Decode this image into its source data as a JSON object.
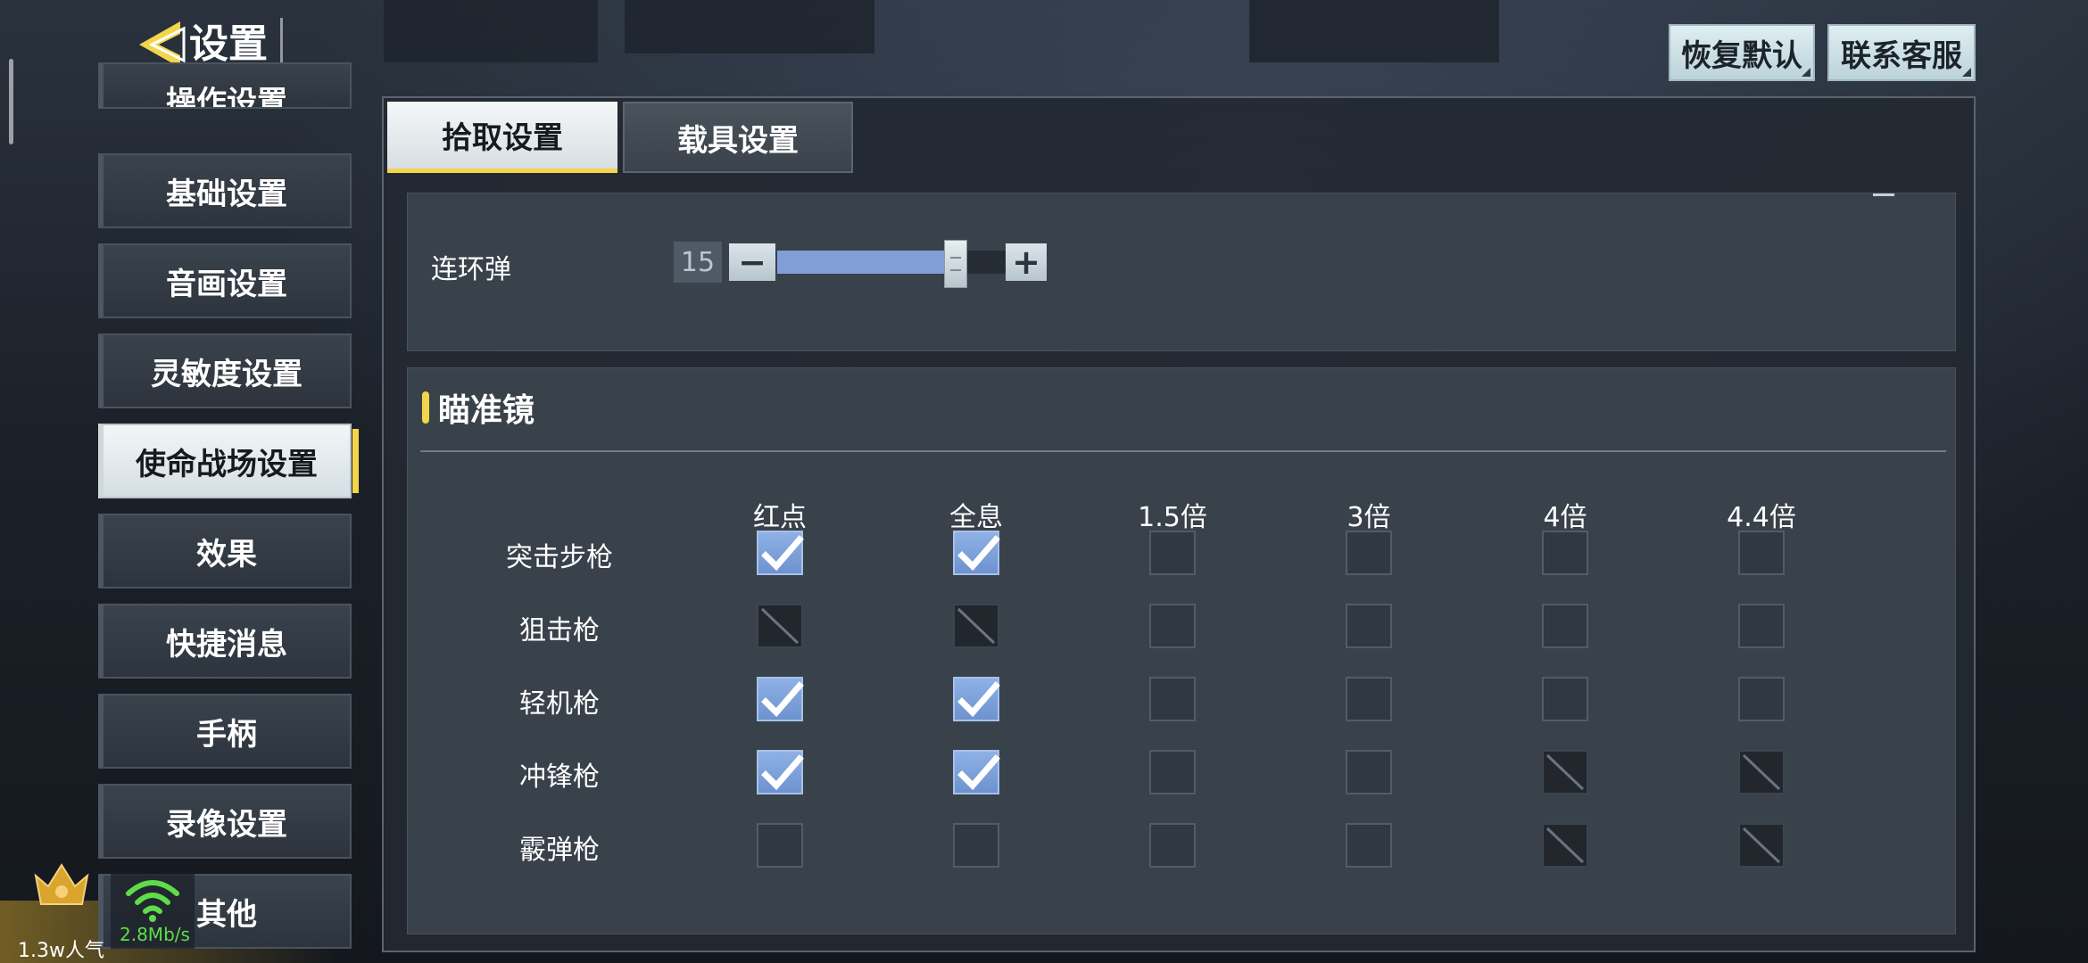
{
  "header": {
    "title": "设置",
    "restore_default": "恢复默认",
    "contact_support": "联系客服"
  },
  "sidebar": {
    "items": [
      {
        "label": "操作设置",
        "state": "partially-visible"
      },
      {
        "label": "基础设置"
      },
      {
        "label": "音画设置"
      },
      {
        "label": "灵敏度设置"
      },
      {
        "label": "使命战场设置",
        "state": "selected"
      },
      {
        "label": "效果"
      },
      {
        "label": "快捷消息"
      },
      {
        "label": "手柄"
      },
      {
        "label": "录像设置"
      },
      {
        "label": "其他"
      }
    ]
  },
  "tabs": [
    {
      "label": "拾取设置",
      "active": true
    },
    {
      "label": "载具设置",
      "active": false
    }
  ],
  "slider": {
    "label": "连环弹",
    "value": "15",
    "minus": "−",
    "plus": "+",
    "fill_fraction": 0.78
  },
  "scope_section": {
    "title": "瞄准镜",
    "columns": [
      "红点",
      "全息",
      "1.5倍",
      "3倍",
      "4倍",
      "4.4倍"
    ],
    "rows": [
      {
        "label": "突击步枪",
        "states": [
          "checked",
          "checked",
          "unchecked",
          "unchecked",
          "unchecked",
          "unchecked"
        ]
      },
      {
        "label": "狙击枪",
        "states": [
          "disabled",
          "disabled",
          "unchecked",
          "unchecked",
          "unchecked",
          "unchecked"
        ]
      },
      {
        "label": "轻机枪",
        "states": [
          "checked",
          "checked",
          "unchecked",
          "unchecked",
          "unchecked",
          "unchecked"
        ]
      },
      {
        "label": "冲锋枪",
        "states": [
          "checked",
          "checked",
          "unchecked",
          "unchecked",
          "disabled",
          "disabled"
        ]
      },
      {
        "label": "霰弹枪",
        "states": [
          "unchecked",
          "unchecked",
          "unchecked",
          "unchecked",
          "disabled",
          "disabled"
        ]
      }
    ]
  },
  "overlay": {
    "popularity": "1.3w人气",
    "net_speed": "2.8Mb/s"
  },
  "colors": {
    "accent_yellow": "#f2d54a",
    "checkbox_checked": "#7fa1db",
    "wifi_green": "#5fdc4a"
  },
  "icons": {
    "back": "back-arrow-icon",
    "check": "checkmark-icon",
    "disabled": "slash-icon",
    "crown": "crown-icon",
    "wifi": "wifi-icon"
  }
}
